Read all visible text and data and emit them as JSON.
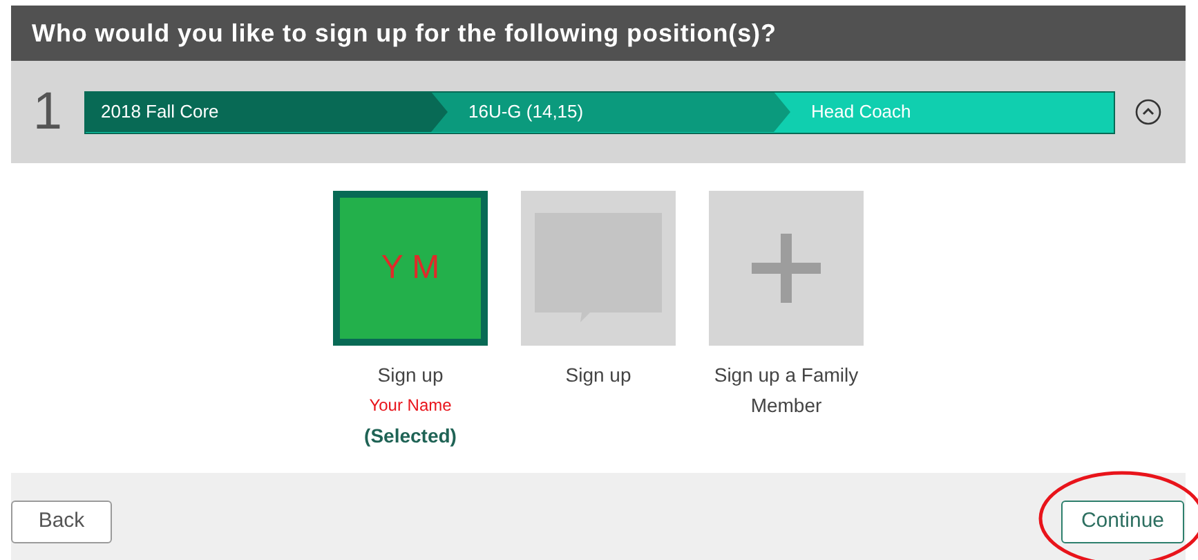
{
  "title": "Who would you like to sign up for the following position(s)?",
  "step": {
    "number": "1",
    "breadcrumbs": [
      "2018 Fall Core",
      "16U-G (14,15)",
      "Head Coach"
    ],
    "expanded": true
  },
  "options": [
    {
      "kind": "person",
      "initials": "Y M",
      "label": "Sign up",
      "name": "Your Name",
      "status": "(Selected)",
      "selected": true
    },
    {
      "kind": "blank",
      "label": "Sign up",
      "selected": false
    },
    {
      "kind": "add",
      "label": "Sign up a Family Member",
      "selected": false
    }
  ],
  "buttons": {
    "back": "Back",
    "continue": "Continue"
  }
}
